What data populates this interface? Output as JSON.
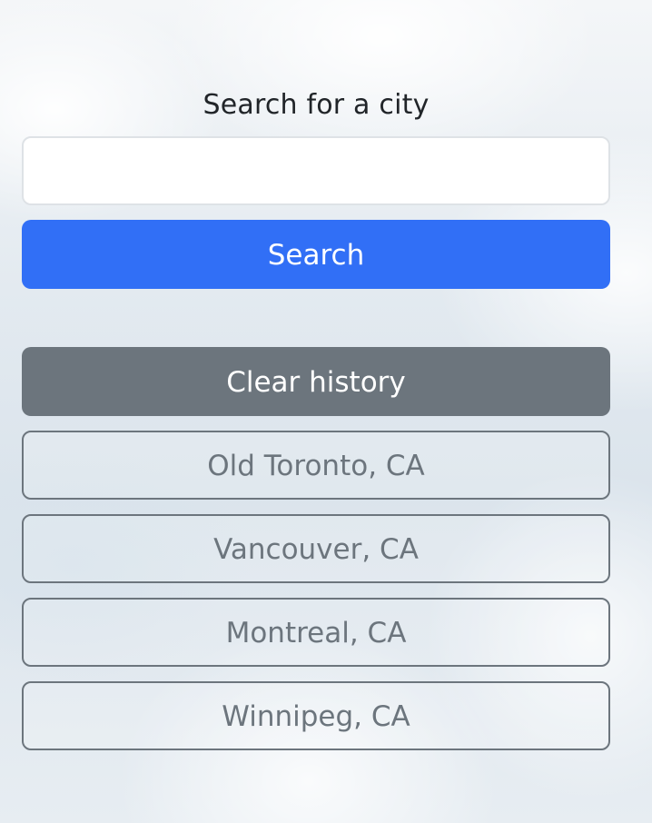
{
  "search": {
    "label": "Search for a city",
    "value": "",
    "placeholder": "",
    "button_label": "Search"
  },
  "history": {
    "clear_label": "Clear history",
    "items": [
      {
        "label": "Old Toronto, CA"
      },
      {
        "label": "Vancouver, CA"
      },
      {
        "label": "Montreal, CA"
      },
      {
        "label": "Winnipeg, CA"
      }
    ]
  },
  "colors": {
    "primary": "#316ff6",
    "secondary": "#6c757d",
    "text": "#212529"
  }
}
